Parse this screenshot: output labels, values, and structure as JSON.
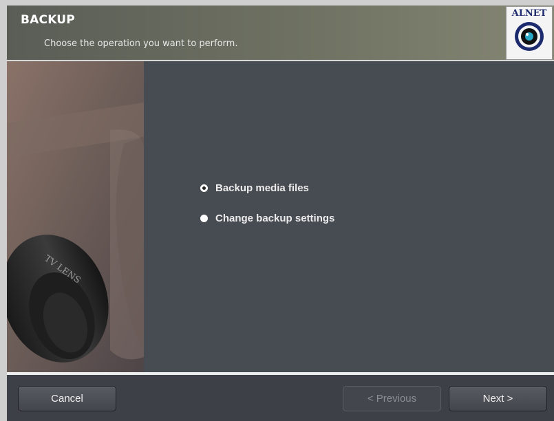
{
  "header": {
    "title": "BACKUP",
    "subtitle": "Choose the operation you want to perform.",
    "logo_text": "ALNET"
  },
  "options": [
    {
      "label": "Backup media files",
      "checked": true
    },
    {
      "label": "Change backup settings",
      "checked": false
    }
  ],
  "footer": {
    "cancel_label": "Cancel",
    "previous_label": "< Previous",
    "next_label": "Next >"
  },
  "colors": {
    "header": "#6f7262",
    "content": "#474b52",
    "footer": "#3d4046",
    "logo_text": "#1c2a6e"
  }
}
